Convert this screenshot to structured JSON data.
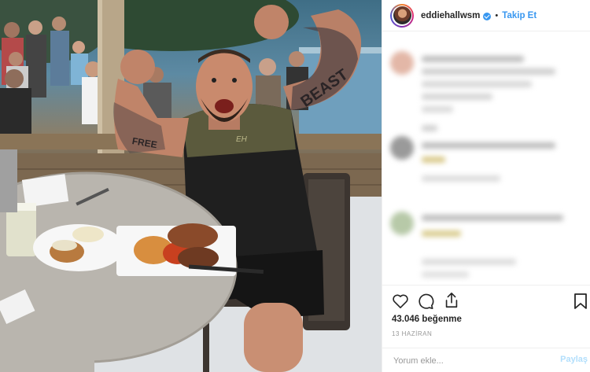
{
  "post": {
    "username": "eddiehallwsm",
    "separator": "•",
    "follow_label": "Takip Et",
    "likes_text": "43.046 beğenme",
    "date_text": "13 HAZİRAN",
    "comment_placeholder": "Yorum ekle...",
    "share_label": "Paylaş",
    "photo_shirt_text": "BEAST",
    "photo_arm_text": "FREE"
  },
  "icons": {
    "verified": "verified-badge-icon",
    "like": "heart-icon",
    "comment": "comment-icon",
    "share": "share-icon",
    "save": "bookmark-icon"
  },
  "colors": {
    "accent": "#3897f0",
    "text": "#262626",
    "muted": "#999999",
    "divider": "#efefef",
    "share_disabled": "#b2dffc"
  }
}
